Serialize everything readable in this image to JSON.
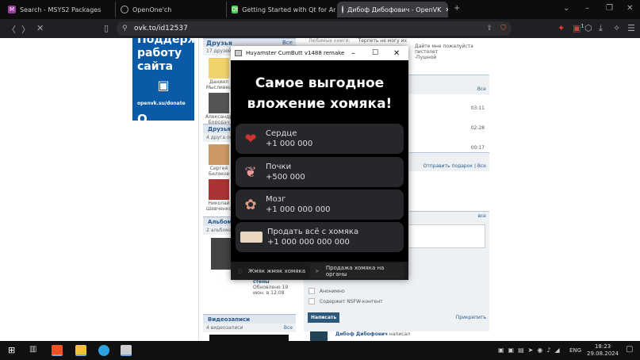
{
  "browser": {
    "tabs": [
      {
        "label": "Search - MSYS2 Packages",
        "icon": "msys2-icon"
      },
      {
        "label": "OpenOne'ch",
        "icon": "globe-icon"
      },
      {
        "label": "Getting Started with Qt for Android",
        "icon": "qt-icon"
      },
      {
        "label": "Дибоф Дибофович - OpenVK",
        "icon": "openvk-icon",
        "active": true
      }
    ],
    "url": "ovk.to/id12537",
    "extension_badge": "1"
  },
  "donate": {
    "title": "Поддержи работу сайта",
    "link": "openvk.su/donate"
  },
  "left": {
    "friends": {
      "title": "Друзья",
      "count": "17 друзей",
      "all": "Все",
      "people": [
        "Даниил Мысливец",
        "Александр Бородач"
      ]
    },
    "online": {
      "title": "Друзья онлайн",
      "count": "4 друга онлайн",
      "people": [
        "Сергей Беляков",
        "Николай Шевченко"
      ]
    },
    "albums": {
      "title": "Альбомы",
      "count": "2 альбома",
      "album_title": "Фотографии со стены",
      "updated": "Обновлено 19 июн. в 12:08"
    },
    "videos": {
      "title": "Видеозаписи",
      "count": "4 видеозаписи",
      "all": "Все"
    }
  },
  "right": {
    "books_label": "Любимые книги:",
    "books_value": "Терпеть не могу их",
    "quote": "Дайте мне пожалуйста пистолет",
    "quote2": "-Пушной",
    "all": "Все",
    "durations": [
      "03:11",
      "02:28",
      "00:17"
    ],
    "gifts": "Отправить подарок",
    "all2": "Все",
    "wall_all": "все",
    "anon": "Анонимно",
    "nsfw": "Содержит NSFW-контент",
    "submit": "Написать",
    "attach": "Прикрепить",
    "post_author": "Дибоф Дибофович",
    "post_action": "написал"
  },
  "dialog": {
    "title": "Huyamster CumButt v1488 remake",
    "heading": "Самое выгодное вложение хомяка!",
    "items": [
      {
        "name": "Сердце",
        "value": "+1 000 000",
        "icon": "heart-organ-icon"
      },
      {
        "name": "Почки",
        "value": "+500 000",
        "icon": "kidneys-icon"
      },
      {
        "name": "Мозг",
        "value": "+1 000 000 000",
        "icon": "brain-icon"
      },
      {
        "name": "Продать всё с хомяка",
        "value": "+1 000 000 000 000",
        "icon": "shawarma-icon"
      }
    ],
    "tabs": [
      {
        "label": "Жмяк жмяк хомяка",
        "icon": "mouse-icon"
      },
      {
        "label": "Продажа хомяка на органы",
        "icon": "send-icon",
        "active": true
      }
    ]
  },
  "taskbar": {
    "lang": "ENG",
    "time": "18:23",
    "date": "29.08.2024"
  }
}
